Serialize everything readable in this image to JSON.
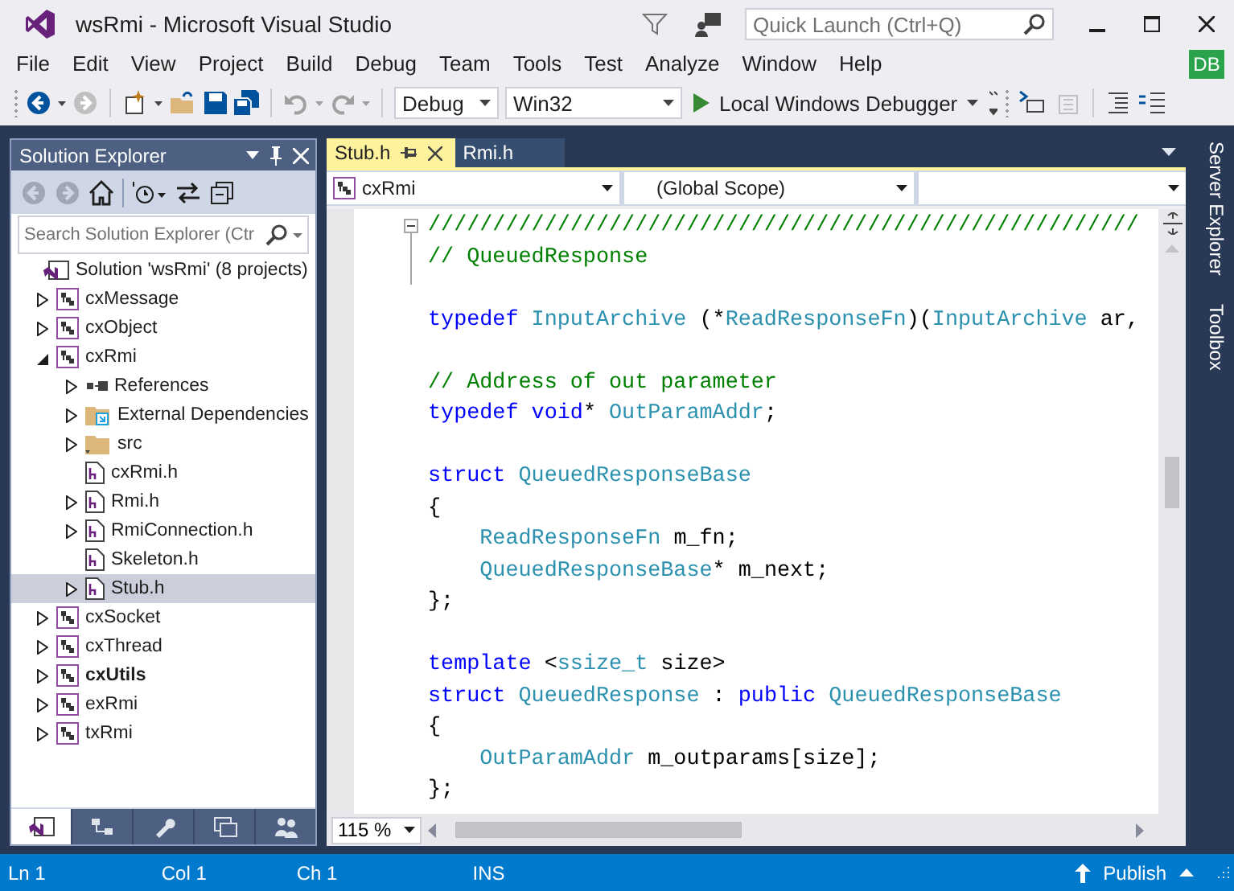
{
  "window": {
    "title": "wsRmi - Microsoft Visual Studio",
    "quick_launch": {
      "placeholder": "Quick Launch (Ctrl+Q)"
    },
    "account_badge": "DB"
  },
  "menu": [
    "File",
    "Edit",
    "View",
    "Project",
    "Build",
    "Debug",
    "Team",
    "Tools",
    "Test",
    "Analyze",
    "Window",
    "Help"
  ],
  "toolbar": {
    "configuration": "Debug",
    "platform": "Win32",
    "run_button": "Local Windows Debugger"
  },
  "solution_explorer": {
    "title": "Solution Explorer",
    "search": {
      "placeholder": "Search Solution Explorer (Ctr"
    },
    "tree": [
      {
        "label": "Solution 'wsRmi' (8 projects)",
        "kind": "solution",
        "expandable": false,
        "selected": false,
        "bold": false,
        "children": [
          {
            "label": "cxMessage",
            "kind": "project",
            "expandable": true,
            "expanded": false,
            "selected": false,
            "bold": false
          },
          {
            "label": "cxObject",
            "kind": "project",
            "expandable": true,
            "expanded": false,
            "selected": false,
            "bold": false
          },
          {
            "label": "cxRmi",
            "kind": "project",
            "expandable": true,
            "expanded": true,
            "selected": false,
            "bold": false,
            "children": [
              {
                "label": "References",
                "kind": "references",
                "expandable": true,
                "expanded": false,
                "selected": false,
                "bold": false
              },
              {
                "label": "External Dependencies",
                "kind": "external",
                "expandable": true,
                "expanded": false,
                "selected": false,
                "bold": false
              },
              {
                "label": "src",
                "kind": "folder",
                "expandable": true,
                "expanded": false,
                "selected": false,
                "bold": false
              },
              {
                "label": "cxRmi.h",
                "kind": "header",
                "expandable": false,
                "selected": false,
                "bold": false
              },
              {
                "label": "Rmi.h",
                "kind": "header",
                "expandable": true,
                "expanded": false,
                "selected": false,
                "bold": false
              },
              {
                "label": "RmiConnection.h",
                "kind": "header",
                "expandable": true,
                "expanded": false,
                "selected": false,
                "bold": false
              },
              {
                "label": "Skeleton.h",
                "kind": "header",
                "expandable": false,
                "selected": false,
                "bold": false
              },
              {
                "label": "Stub.h",
                "kind": "header",
                "expandable": true,
                "expanded": false,
                "selected": true,
                "bold": false
              }
            ]
          },
          {
            "label": "cxSocket",
            "kind": "project",
            "expandable": true,
            "expanded": false,
            "selected": false,
            "bold": false
          },
          {
            "label": "cxThread",
            "kind": "project",
            "expandable": true,
            "expanded": false,
            "selected": false,
            "bold": false
          },
          {
            "label": "cxUtils",
            "kind": "project",
            "expandable": true,
            "expanded": false,
            "selected": false,
            "bold": true
          },
          {
            "label": "exRmi",
            "kind": "project",
            "expandable": true,
            "expanded": false,
            "selected": false,
            "bold": false
          },
          {
            "label": "txRmi",
            "kind": "project",
            "expandable": true,
            "expanded": false,
            "selected": false,
            "bold": false
          }
        ]
      }
    ],
    "bottom_tabs": [
      {
        "kind": "solution",
        "selected": true
      },
      {
        "kind": "classes",
        "selected": false
      },
      {
        "kind": "properties",
        "selected": false
      },
      {
        "kind": "team",
        "selected": false
      },
      {
        "kind": "users",
        "selected": false
      }
    ]
  },
  "editor": {
    "tabs": [
      {
        "label": "Stub.h",
        "selected": true
      },
      {
        "label": "Rmi.h",
        "selected": false
      }
    ],
    "navigation": {
      "project": "cxRmi",
      "scope": "(Global Scope)"
    },
    "lines": [
      {
        "kind": "code",
        "fold_start": true,
        "tokens": [
          {
            "text": "///////////////////////////////////////////////////////",
            "kind": "comment"
          }
        ]
      },
      {
        "kind": "code",
        "fold_start": false,
        "tokens": [
          {
            "text": "// QueuedResponse",
            "kind": "comment"
          }
        ]
      },
      {
        "kind": "blank",
        "fold_start": false
      },
      {
        "kind": "code",
        "fold_start": false,
        "tokens": [
          {
            "text": "typedef",
            "kind": "keyword"
          },
          {
            "text": " InputArchive",
            "kind": "type"
          },
          {
            "text": " (*",
            "kind": "plain"
          },
          {
            "text": "ReadResponseFn",
            "kind": "type"
          },
          {
            "text": ")(",
            "kind": "plain"
          },
          {
            "text": "InputArchive",
            "kind": "type"
          },
          {
            "text": " ar,",
            "kind": "plain"
          }
        ]
      },
      {
        "kind": "blank",
        "fold_start": false
      },
      {
        "kind": "code",
        "fold_start": false,
        "tokens": [
          {
            "text": "// Address of out parameter",
            "kind": "comment"
          }
        ]
      },
      {
        "kind": "code",
        "fold_start": false,
        "tokens": [
          {
            "text": "typedef",
            "kind": "keyword"
          },
          {
            "text": " void",
            "kind": "keyword"
          },
          {
            "text": "* ",
            "kind": "plain"
          },
          {
            "text": "OutParamAddr",
            "kind": "type"
          },
          {
            "text": ";",
            "kind": "plain"
          }
        ]
      },
      {
        "kind": "blank",
        "fold_start": false
      },
      {
        "kind": "code",
        "fold_start": false,
        "tokens": [
          {
            "text": "struct",
            "kind": "keyword"
          },
          {
            "text": " QueuedResponseBase",
            "kind": "type"
          }
        ]
      },
      {
        "kind": "code",
        "fold_start": false,
        "tokens": [
          {
            "text": "{",
            "kind": "plain"
          }
        ]
      },
      {
        "kind": "code",
        "fold_start": false,
        "tokens": [
          {
            "text": "    ReadResponseFn",
            "kind": "type"
          },
          {
            "text": " m_fn;",
            "kind": "plain"
          }
        ]
      },
      {
        "kind": "code",
        "fold_start": false,
        "tokens": [
          {
            "text": "    QueuedResponseBase",
            "kind": "type"
          },
          {
            "text": "* m_next;",
            "kind": "plain"
          }
        ]
      },
      {
        "kind": "code",
        "fold_start": false,
        "tokens": [
          {
            "text": "};",
            "kind": "plain"
          }
        ]
      },
      {
        "kind": "blank",
        "fold_start": false
      },
      {
        "kind": "code",
        "fold_start": false,
        "tokens": [
          {
            "text": "template",
            "kind": "keyword"
          },
          {
            "text": " <",
            "kind": "plain"
          },
          {
            "text": "ssize_t",
            "kind": "type"
          },
          {
            "text": " size>",
            "kind": "plain"
          }
        ]
      },
      {
        "kind": "code",
        "fold_start": false,
        "tokens": [
          {
            "text": "struct",
            "kind": "keyword"
          },
          {
            "text": " QueuedResponse",
            "kind": "type"
          },
          {
            "text": " : ",
            "kind": "plain"
          },
          {
            "text": "public",
            "kind": "keyword"
          },
          {
            "text": " QueuedResponseBase",
            "kind": "type"
          }
        ]
      },
      {
        "kind": "code",
        "fold_start": false,
        "tokens": [
          {
            "text": "{",
            "kind": "plain"
          }
        ]
      },
      {
        "kind": "code",
        "fold_start": false,
        "tokens": [
          {
            "text": "    OutParamAddr",
            "kind": "type"
          },
          {
            "text": " m_outparams[size];",
            "kind": "plain"
          }
        ]
      },
      {
        "kind": "code",
        "fold_start": false,
        "tokens": [
          {
            "text": "};",
            "kind": "plain"
          }
        ]
      }
    ],
    "zoom": "115 %"
  },
  "side_tabs": [
    "Server Explorer",
    "Toolbox"
  ],
  "status_bar": {
    "line": "Ln 1",
    "column": "Col 1",
    "char": "Ch 1",
    "mode": "INS",
    "publish": "Publish"
  }
}
